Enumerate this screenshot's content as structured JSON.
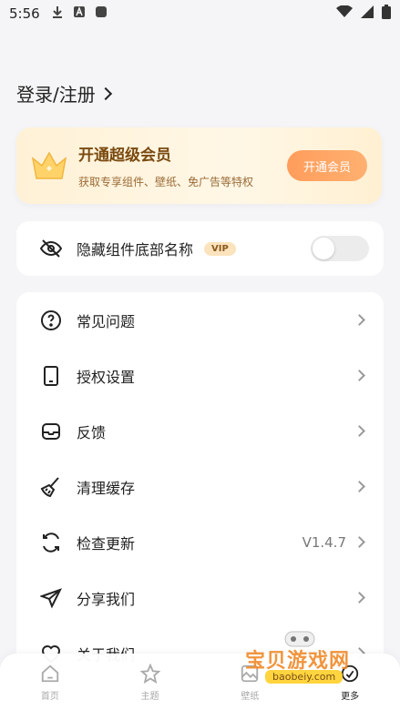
{
  "status_bar": {
    "time": "5:56"
  },
  "login": {
    "label": "登录/注册"
  },
  "vip_card": {
    "title": "开通超级会员",
    "subtitle": "获取专享组件、壁纸、免广告等特权",
    "button": "开通会员"
  },
  "toggle_row": {
    "label": "隐藏组件底部名称",
    "tag": "VIP",
    "enabled": false
  },
  "menu": [
    {
      "label": "常见问题",
      "icon": "question-icon"
    },
    {
      "label": "授权设置",
      "icon": "phone-icon"
    },
    {
      "label": "反馈",
      "icon": "mailbox-icon"
    },
    {
      "label": "清理缓存",
      "icon": "broom-icon"
    },
    {
      "label": "检查更新",
      "icon": "refresh-icon",
      "value": "V1.4.7"
    },
    {
      "label": "分享我们",
      "icon": "paper-plane-icon"
    },
    {
      "label": "关于我们",
      "icon": "heart-icon"
    }
  ],
  "bottom_nav": [
    {
      "label": "首页",
      "icon": "home-icon"
    },
    {
      "label": "主题",
      "icon": "star-icon"
    },
    {
      "label": "壁纸",
      "icon": "image-icon"
    },
    {
      "label": "更多",
      "icon": "more-icon"
    }
  ],
  "watermark": {
    "title": "宝贝游戏网",
    "url": "baobeiy.com"
  },
  "colors": {
    "accent": "#ffa066",
    "vip_brown": "#7a4a10"
  }
}
